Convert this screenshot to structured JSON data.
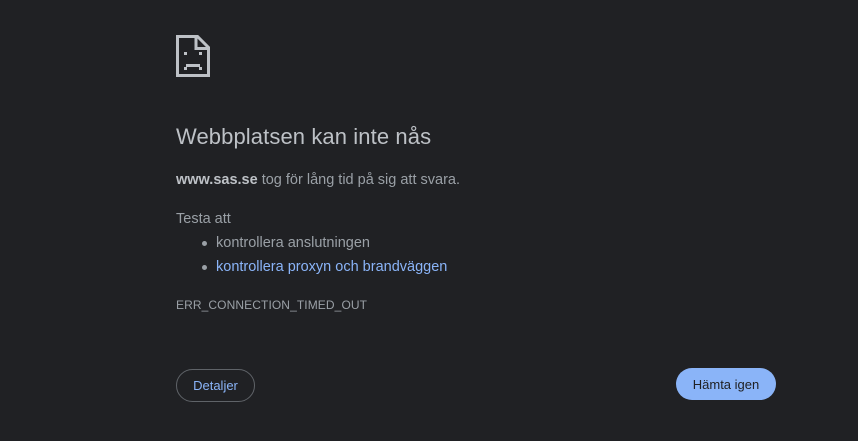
{
  "error_page": {
    "icon": "sad-page-icon",
    "title": "Webbplatsen kan inte nås",
    "host": "www.sas.se",
    "message_rest": " tog för lång tid på sig att svara.",
    "suggestions_heading": "Testa att",
    "suggestions": [
      "kontrollera anslutningen",
      "kontrollera proxyn och brandväggen"
    ],
    "error_code": "ERR_CONNECTION_TIMED_OUT"
  },
  "buttons": {
    "details_label": "Detaljer",
    "reload_label": "Hämta igen"
  },
  "colors": {
    "background": "#202124",
    "text": "#9aa0a6",
    "title": "#bdc1c6",
    "link": "#8ab4f8",
    "primary_button": "#8ab4f8"
  }
}
